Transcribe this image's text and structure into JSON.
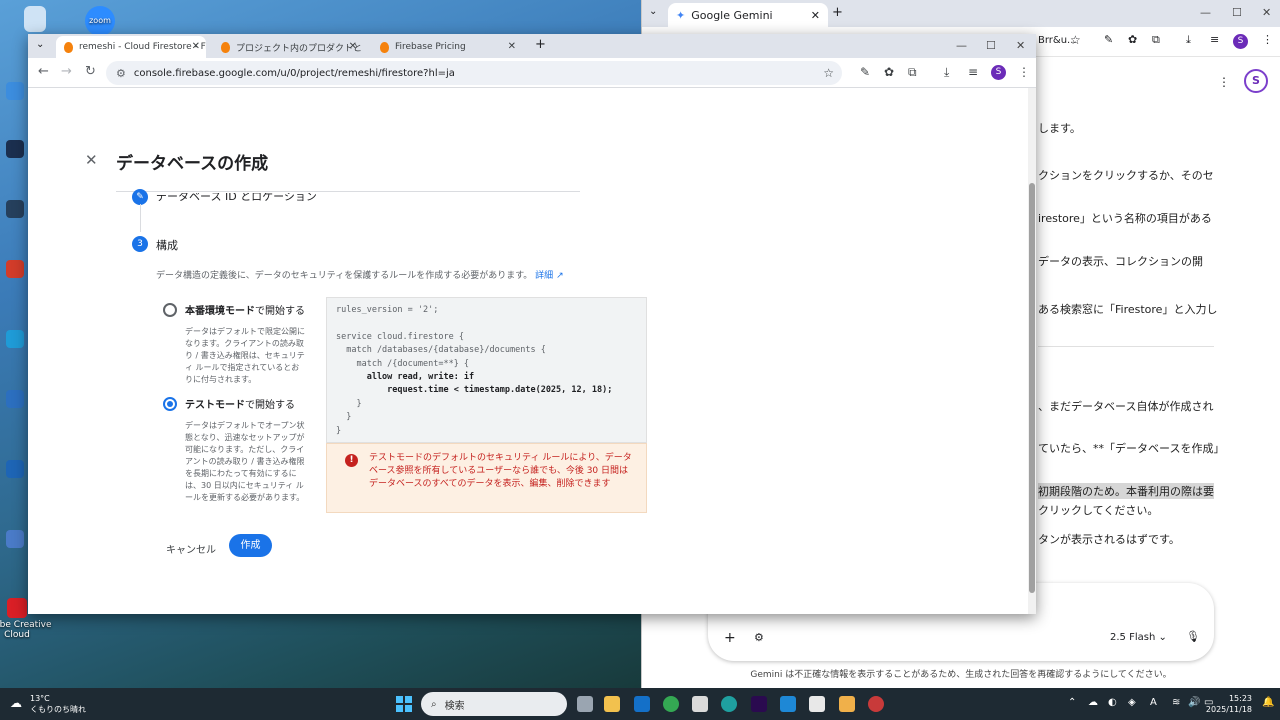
{
  "desktop": {
    "icons": [
      "zoom",
      "Adobe Creative Cloud"
    ]
  },
  "gemini_window": {
    "tab_title": "Google Gemini",
    "omnibox_partial": "Brr&u...",
    "avatar": "S",
    "lines": [
      "します。",
      "クションをクリックするか、そのセ",
      "irestore」という名称の項目がある",
      "データの表示、コレクションの開",
      "ある検索窓に「Firestore」と入力し",
      "、まだデータベース自体が作成され",
      "ていたら、**「データベースを作成」",
      "初期段階のため。本番利用の際は要",
      "クリックしてください。",
      "タンが表示されるはずです。"
    ],
    "model_label": "2.5 Flash",
    "footer": "Gemini は不正確な情報を表示することがあるため、生成された回答を再確認するようにしてください。"
  },
  "browser": {
    "tabs": [
      {
        "title": "remeshi - Cloud Firestore - Fire"
      },
      {
        "title": "プロジェクト内のプロダクトとリソースの"
      },
      {
        "title": "Firebase Pricing"
      }
    ],
    "url": "console.firebase.google.com/u/0/project/remeshi/firestore?hl=ja",
    "avatar": "S"
  },
  "dialog": {
    "title": "データベースの作成",
    "step2_label": "データベース ID とロケーション",
    "step3_number": "3",
    "step3_label": "構成",
    "description": "データ構造の定義後に、データのセキュリティを保護するルールを作成する必要があります。",
    "details_link": "詳細",
    "prod_mode": {
      "title_bold": "本番環境モード",
      "title_rest": "で開始する",
      "description": "データはデフォルトで限定公開になります。クライアントの読み取り / 書き込み権限は、セキュリティ ルールで指定されているとおりに付与されます。"
    },
    "test_mode": {
      "title_bold": "テストモード",
      "title_rest": "で開始する",
      "description": "データはデフォルトでオープン状態となり、迅速なセットアップが可能になります。ただし、クライアントの読み取り / 書き込み権限を長期にわたって有効にするには、30 日以内にセキュリティ ルールを更新する必要があります。"
    },
    "rules_code": [
      "rules_version = '2';",
      "",
      "service cloud.firestore {",
      "  match /databases/{database}/documents {",
      "    match /{document=**} {",
      "      allow read, write: if",
      "          request.time < timestamp.date(2025, 12, 18);",
      "    }",
      "  }",
      "}"
    ],
    "warning": "テストモードのデフォルトのセキュリティ ルールにより、データベース参照を所有しているユーザーなら誰でも、今後 30 日間はデータベースのすべてのデータを表示、編集、削除できます",
    "cancel_label": "キャンセル",
    "create_label": "作成"
  },
  "taskbar": {
    "weather_temp": "13°C",
    "weather_desc": "くもりのち晴れ",
    "search_placeholder": "検索",
    "time": "15:23",
    "date": "2025/11/18"
  }
}
